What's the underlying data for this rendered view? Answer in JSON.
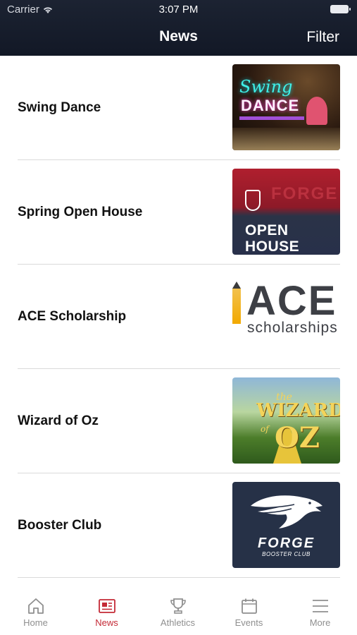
{
  "status_bar": {
    "carrier": "Carrier",
    "time": "3:07 PM"
  },
  "header": {
    "title": "News",
    "filter_label": "Filter"
  },
  "news": [
    {
      "title": "Swing Dance",
      "thumb": {
        "line1": "Swing",
        "line2": "DANCE"
      }
    },
    {
      "title": "Spring Open House",
      "thumb": {
        "bg": "FORGE",
        "line1": "OPEN",
        "line2": "HOUSE"
      }
    },
    {
      "title": "ACE Scholarship",
      "thumb": {
        "line1": "ACE",
        "line2": "scholarships"
      }
    },
    {
      "title": "Wizard of Oz",
      "thumb": {
        "the": "the",
        "line1": "WIZARD",
        "of": "of",
        "line2": "OZ"
      }
    },
    {
      "title": "Booster Club",
      "thumb": {
        "line1": "FORGE",
        "line2": "BOOSTER CLUB"
      }
    }
  ],
  "tabs": [
    {
      "label": "Home",
      "icon": "home-icon"
    },
    {
      "label": "News",
      "icon": "newspaper-icon",
      "active": true
    },
    {
      "label": "Athletics",
      "icon": "trophy-icon"
    },
    {
      "label": "Events",
      "icon": "calendar-icon"
    },
    {
      "label": "More",
      "icon": "menu-icon"
    }
  ],
  "colors": {
    "header_bg": "#1c2332",
    "accent": "#c42a36",
    "tab_inactive": "#8f8f8f"
  }
}
